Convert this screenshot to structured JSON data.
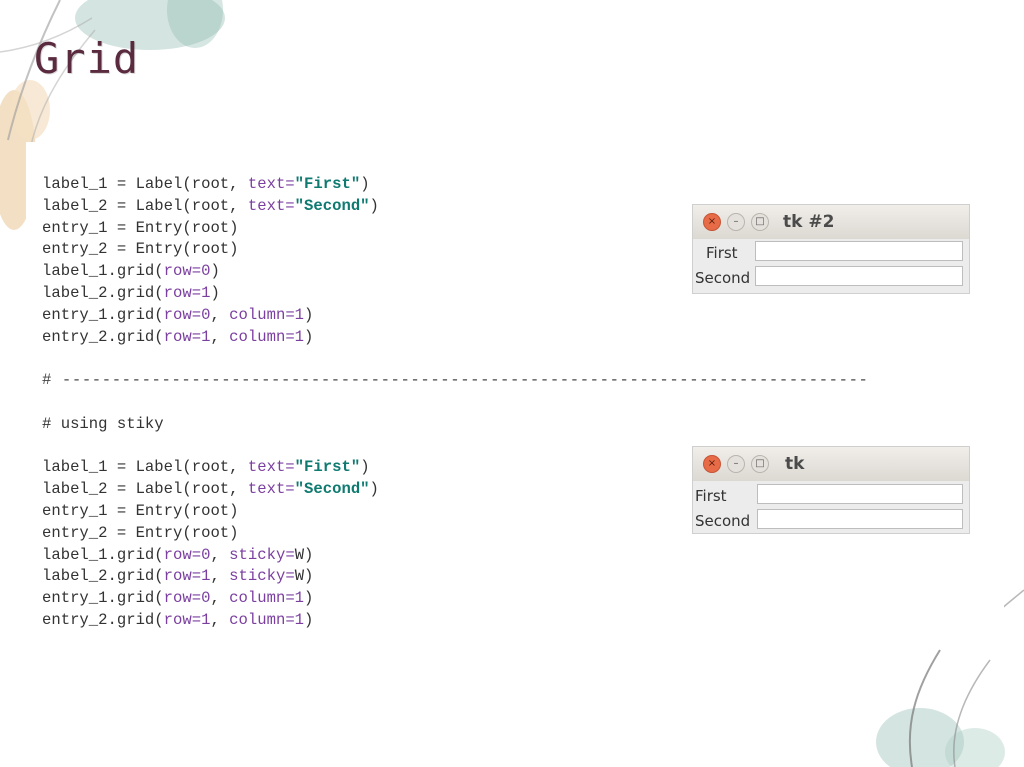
{
  "slide": {
    "title": "Grid"
  },
  "code": {
    "block1": [
      [
        {
          "t": "label_1 = Label(root, "
        },
        {
          "t": "text=",
          "c": "kw"
        },
        {
          "t": "\"First\"",
          "c": "str"
        },
        {
          "t": ")"
        }
      ],
      [
        {
          "t": "label_2 = Label(root, "
        },
        {
          "t": "text=",
          "c": "kw"
        },
        {
          "t": "\"Second\"",
          "c": "str"
        },
        {
          "t": ")"
        }
      ],
      [
        {
          "t": "entry_1 = Entry(root)"
        }
      ],
      [
        {
          "t": "entry_2 = Entry(root)"
        }
      ],
      [
        {
          "t": "label_1.grid("
        },
        {
          "t": "row=0",
          "c": "kw"
        },
        {
          "t": ")"
        }
      ],
      [
        {
          "t": "label_2.grid("
        },
        {
          "t": "row=1",
          "c": "kw"
        },
        {
          "t": ")"
        }
      ],
      [
        {
          "t": "entry_1.grid("
        },
        {
          "t": "row=0",
          "c": "kw"
        },
        {
          "t": ", "
        },
        {
          "t": "column=1",
          "c": "kw"
        },
        {
          "t": ")"
        }
      ],
      [
        {
          "t": "entry_2.grid("
        },
        {
          "t": "row=1",
          "c": "kw"
        },
        {
          "t": ", "
        },
        {
          "t": "column=1",
          "c": "kw"
        },
        {
          "t": ")"
        }
      ]
    ],
    "separator": "# ---------------------------------------------------------------------------------",
    "comment": "# using stiky",
    "block2": [
      [
        {
          "t": "label_1 = Label(root, "
        },
        {
          "t": "text=",
          "c": "kw"
        },
        {
          "t": "\"First\"",
          "c": "str"
        },
        {
          "t": ")"
        }
      ],
      [
        {
          "t": "label_2 = Label(root, "
        },
        {
          "t": "text=",
          "c": "kw"
        },
        {
          "t": "\"Second\"",
          "c": "str"
        },
        {
          "t": ")"
        }
      ],
      [
        {
          "t": "entry_1 = Entry(root)"
        }
      ],
      [
        {
          "t": "entry_2 = Entry(root)"
        }
      ],
      [
        {
          "t": "label_1.grid("
        },
        {
          "t": "row=0",
          "c": "kw"
        },
        {
          "t": ", "
        },
        {
          "t": "sticky=",
          "c": "kw"
        },
        {
          "t": "W)"
        }
      ],
      [
        {
          "t": "label_2.grid("
        },
        {
          "t": "row=1",
          "c": "kw"
        },
        {
          "t": ", "
        },
        {
          "t": "sticky=",
          "c": "kw"
        },
        {
          "t": "W)"
        }
      ],
      [
        {
          "t": "entry_1.grid("
        },
        {
          "t": "row=0",
          "c": "kw"
        },
        {
          "t": ", "
        },
        {
          "t": "column=1",
          "c": "kw"
        },
        {
          "t": ")"
        }
      ],
      [
        {
          "t": "entry_2.grid("
        },
        {
          "t": "row=1",
          "c": "kw"
        },
        {
          "t": ", "
        },
        {
          "t": "column=1",
          "c": "kw"
        },
        {
          "t": ")"
        }
      ]
    ]
  },
  "windows": [
    {
      "title": "tk #2",
      "close_glyph": "×",
      "min_glyph": "–",
      "max_glyph": "□",
      "labels": [
        "First",
        "Second"
      ],
      "entries": [
        "",
        ""
      ]
    },
    {
      "title": "tk",
      "close_glyph": "×",
      "min_glyph": "–",
      "max_glyph": "□",
      "labels": [
        "First",
        "Second"
      ],
      "entries": [
        "",
        ""
      ]
    }
  ],
  "colors": {
    "title": "#5a2a3e",
    "keyword": "#7b3fa0",
    "string": "#0f7a70",
    "close_button": "#e86b47"
  }
}
